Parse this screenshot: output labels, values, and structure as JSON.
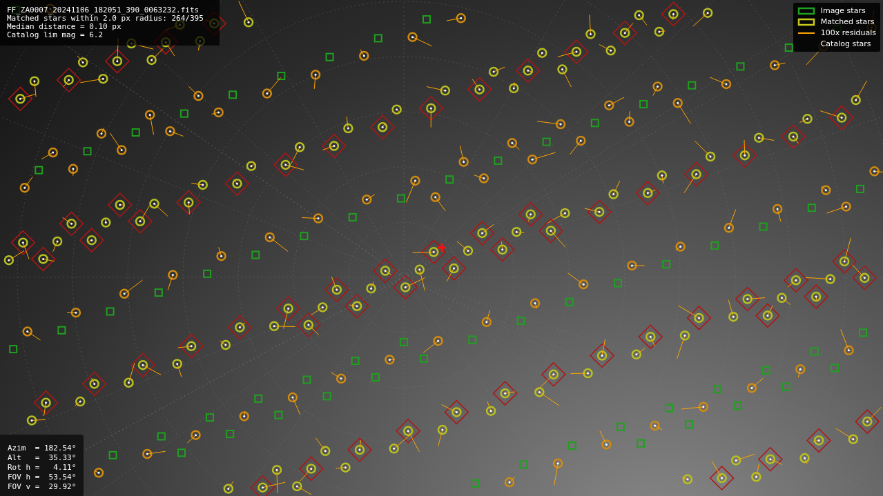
{
  "header": {
    "lines": [
      "FF_ZA0007_20241106_182051_390_0063232.fits",
      "Matched stars within 2.0 px radius: 264/395",
      "Median distance = 0.10 px",
      "Catalog lim mag = 6.2"
    ]
  },
  "legend": [
    {
      "kind": "box",
      "label": "Image stars",
      "color": "#1fa01f"
    },
    {
      "kind": "box",
      "label": "Matched stars",
      "color": "#c8c81e"
    },
    {
      "kind": "line",
      "label": "100x residuals",
      "color": "#ffa500"
    },
    {
      "kind": "diamond",
      "label": "Catalog stars"
    }
  ],
  "pointing": {
    "lines": [
      "Azim  = 182.54°",
      "Alt   =  35.33°",
      "Rot h =   4.11°",
      "FOV h =  53.54°",
      "FOV v =  29.92°"
    ]
  }
}
